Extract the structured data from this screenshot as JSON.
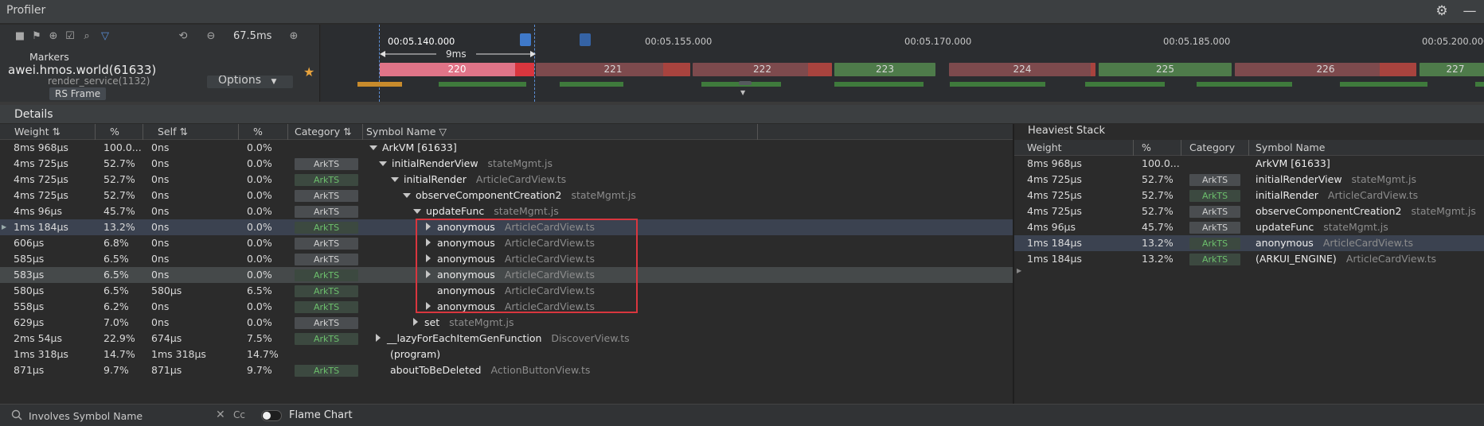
{
  "window": {
    "title": "Profiler"
  },
  "toolbar": {
    "zoom": "67.5ms",
    "markers_label": "Markers",
    "process": "awei.hmos.world(61633)",
    "clipped_row": "render_service(1132)",
    "rs_frame": "RS Frame",
    "options": "Options"
  },
  "timeline": {
    "ticks": [
      "00:05.140.000",
      "00:05.155.000",
      "00:05.170.000",
      "00:05.185.000",
      "00:05.200.000"
    ],
    "selection_duration": "9ms",
    "frames": [
      "220",
      "221",
      "222",
      "223",
      "224",
      "225",
      "226",
      "227"
    ],
    "colors": {
      "selected_frame": "#e07488",
      "janky_frame": "#7d4a4d",
      "normal_frame": "#4e7b4a",
      "overrun": "#a8433e"
    }
  },
  "details": {
    "title": "Details",
    "headers": {
      "weight": "Weight",
      "pct": "%",
      "self": "Self",
      "self_pct": "%",
      "category": "Category",
      "symbol": "Symbol Name"
    },
    "rows": [
      {
        "w": "8ms 968µs",
        "p": "100.0...",
        "s": "0ns",
        "sp": "0.0%",
        "cat": "",
        "sym": "ArkVM [61633]",
        "file": ""
      },
      {
        "w": "4ms 725µs",
        "p": "52.7%",
        "s": "0ns",
        "sp": "0.0%",
        "cat": "ArkTS",
        "sym": "initialRenderView",
        "file": "stateMgmt.js"
      },
      {
        "w": "4ms 725µs",
        "p": "52.7%",
        "s": "0ns",
        "sp": "0.0%",
        "cat": "ArkTS",
        "sym": "initialRender",
        "file": "ArticleCardView.ts"
      },
      {
        "w": "4ms 725µs",
        "p": "52.7%",
        "s": "0ns",
        "sp": "0.0%",
        "cat": "ArkTS",
        "sym": "observeComponentCreation2",
        "file": "stateMgmt.js"
      },
      {
        "w": "4ms 96µs",
        "p": "45.7%",
        "s": "0ns",
        "sp": "0.0%",
        "cat": "ArkTS",
        "sym": "updateFunc",
        "file": "stateMgmt.js"
      },
      {
        "w": "1ms 184µs",
        "p": "13.2%",
        "s": "0ns",
        "sp": "0.0%",
        "cat": "ArkTS",
        "sym": "anonymous",
        "file": "ArticleCardView.ts"
      },
      {
        "w": "606µs",
        "p": "6.8%",
        "s": "0ns",
        "sp": "0.0%",
        "cat": "ArkTS",
        "sym": "anonymous",
        "file": "ArticleCardView.ts"
      },
      {
        "w": "585µs",
        "p": "6.5%",
        "s": "0ns",
        "sp": "0.0%",
        "cat": "ArkTS",
        "sym": "anonymous",
        "file": "ArticleCardView.ts"
      },
      {
        "w": "583µs",
        "p": "6.5%",
        "s": "0ns",
        "sp": "0.0%",
        "cat": "ArkTS",
        "sym": "anonymous",
        "file": "ArticleCardView.ts"
      },
      {
        "w": "580µs",
        "p": "6.5%",
        "s": "580µs",
        "sp": "6.5%",
        "cat": "ArkTS",
        "sym": "anonymous",
        "file": "ArticleCardView.ts"
      },
      {
        "w": "558µs",
        "p": "6.2%",
        "s": "0ns",
        "sp": "0.0%",
        "cat": "ArkTS",
        "sym": "anonymous",
        "file": "ArticleCardView.ts"
      },
      {
        "w": "629µs",
        "p": "7.0%",
        "s": "0ns",
        "sp": "0.0%",
        "cat": "ArkTS",
        "sym": "set",
        "file": "stateMgmt.js"
      },
      {
        "w": "2ms 54µs",
        "p": "22.9%",
        "s": "674µs",
        "sp": "7.5%",
        "cat": "ArkTS",
        "sym": "__lazyForEachItemGenFunction",
        "file": "DiscoverView.ts"
      },
      {
        "w": "1ms 318µs",
        "p": "14.7%",
        "s": "1ms 318µs",
        "sp": "14.7%",
        "cat": "",
        "sym": "(program)",
        "file": ""
      },
      {
        "w": "871µs",
        "p": "9.7%",
        "s": "871µs",
        "sp": "9.7%",
        "cat": "ArkTS",
        "sym": "aboutToBeDeleted",
        "file": "ActionButtonView.ts"
      }
    ]
  },
  "heaviest": {
    "title": "Heaviest Stack",
    "headers": {
      "weight": "Weight",
      "pct": "%",
      "category": "Category",
      "symbol": "Symbol Name"
    },
    "rows": [
      {
        "w": "8ms 968µs",
        "p": "100.0...",
        "cat": "",
        "sym": "ArkVM [61633]",
        "file": ""
      },
      {
        "w": "4ms 725µs",
        "p": "52.7%",
        "cat": "ArkTS",
        "sym": "initialRenderView",
        "file": "stateMgmt.js"
      },
      {
        "w": "4ms 725µs",
        "p": "52.7%",
        "cat": "ArkTS",
        "sym": "initialRender",
        "file": "ArticleCardView.ts"
      },
      {
        "w": "4ms 725µs",
        "p": "52.7%",
        "cat": "ArkTS",
        "sym": "observeComponentCreation2",
        "file": "stateMgmt.js"
      },
      {
        "w": "4ms 96µs",
        "p": "45.7%",
        "cat": "ArkTS",
        "sym": "updateFunc",
        "file": "stateMgmt.js"
      },
      {
        "w": "1ms 184µs",
        "p": "13.2%",
        "cat": "ArkTS",
        "sym": "anonymous",
        "file": "ArticleCardView.ts"
      },
      {
        "w": "1ms 184µs",
        "p": "13.2%",
        "cat": "ArkTS",
        "sym": "(ARKUI_ENGINE)",
        "file": "ArticleCardView.ts"
      }
    ]
  },
  "bottom": {
    "search_placeholder": "Involves Symbol Name",
    "cc": "Cc",
    "flame_chart": "Flame Chart"
  }
}
